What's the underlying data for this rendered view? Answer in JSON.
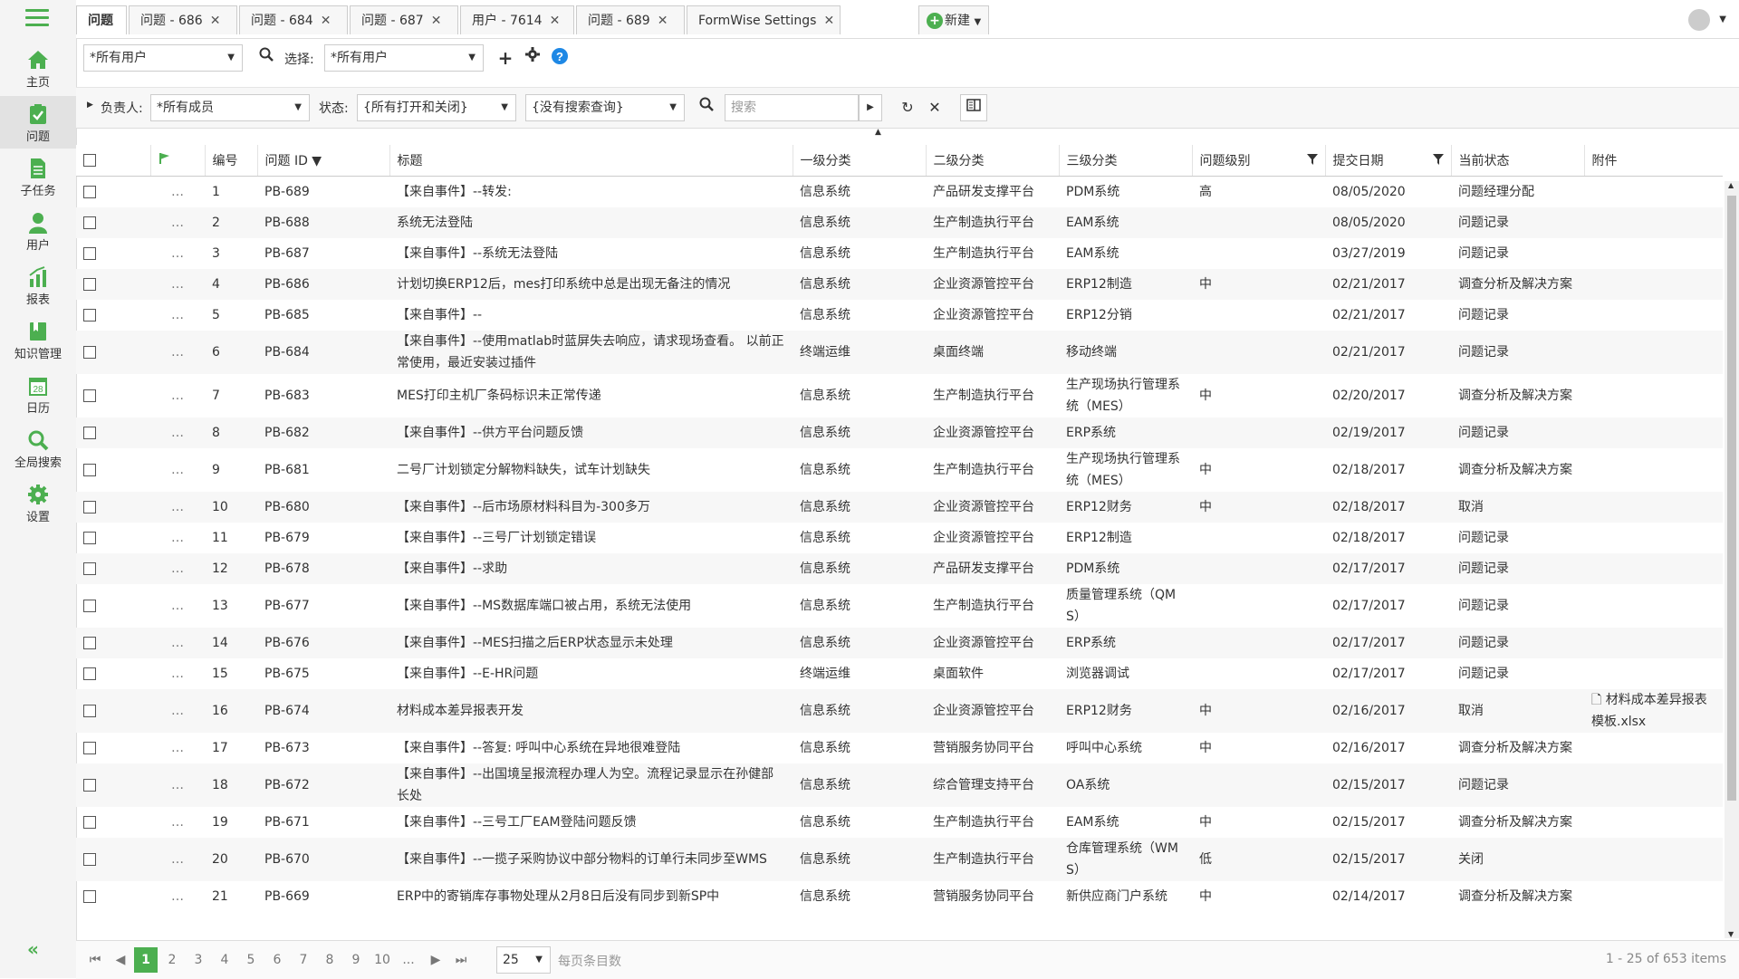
{
  "sidebar": {
    "items": [
      {
        "label": "主页",
        "icon": "home-icon"
      },
      {
        "label": "问题",
        "icon": "issue-check-icon"
      },
      {
        "label": "子任务",
        "icon": "subtask-icon"
      },
      {
        "label": "用户",
        "icon": "user-icon"
      },
      {
        "label": "报表",
        "icon": "report-icon"
      },
      {
        "label": "知识管理",
        "icon": "book-icon"
      },
      {
        "label": "日历",
        "icon": "calendar-icon",
        "badge": "28"
      },
      {
        "label": "全局搜索",
        "icon": "search-icon"
      },
      {
        "label": "设置",
        "icon": "gear-icon"
      }
    ],
    "collapse": "«"
  },
  "tabs": [
    {
      "label": "问题"
    },
    {
      "label": "问题 - 686"
    },
    {
      "label": "问题 - 684"
    },
    {
      "label": "问题 - 687"
    },
    {
      "label": "用户 - 7614"
    },
    {
      "label": "问题 - 689"
    },
    {
      "label": "FormWise Settings"
    }
  ],
  "new_button": "新建",
  "toolbar": {
    "user_filter": "*所有用户",
    "select_label": "选择:",
    "select_value": "*所有用户"
  },
  "filters": {
    "assignee_label": "负责人:",
    "assignee_value": "*所有成员",
    "status_label": "状态:",
    "status_value": "{所有打开和关闭}",
    "query_value": "{没有搜索查询}",
    "search_placeholder": "搜索"
  },
  "columns": [
    "编号",
    "问题 ID ▼",
    "标题",
    "一级分类",
    "二级分类",
    "三级分类",
    "问题级别",
    "提交日期",
    "当前状态",
    "附件"
  ],
  "rows": [
    {
      "n": "1",
      "id": "PB-689",
      "title": "【来自事件】--转发:",
      "c1": "信息系统",
      "c2": "产品研发支撑平台",
      "c3": "PDM系统",
      "level": "高",
      "date": "08/05/2020",
      "status": "问题经理分配",
      "att": ""
    },
    {
      "n": "2",
      "id": "PB-688",
      "title": "系统无法登陆",
      "c1": "信息系统",
      "c2": "生产制造执行平台",
      "c3": "EAM系统",
      "level": "",
      "date": "08/05/2020",
      "status": "问题记录",
      "att": ""
    },
    {
      "n": "3",
      "id": "PB-687",
      "title": "【来自事件】--系统无法登陆",
      "c1": "信息系统",
      "c2": "生产制造执行平台",
      "c3": "EAM系统",
      "level": "",
      "date": "03/27/2019",
      "status": "问题记录",
      "att": ""
    },
    {
      "n": "4",
      "id": "PB-686",
      "title": "计划切换ERP12后，mes打印系统中总是出现无备注的情况",
      "c1": "信息系统",
      "c2": "企业资源管控平台",
      "c3": "ERP12制造",
      "level": "中",
      "date": "02/21/2017",
      "status": "调查分析及解决方案",
      "att": ""
    },
    {
      "n": "5",
      "id": "PB-685",
      "title": "【来自事件】--",
      "c1": "信息系统",
      "c2": "企业资源管控平台",
      "c3": "ERP12分销",
      "level": "",
      "date": "02/21/2017",
      "status": "问题记录",
      "att": ""
    },
    {
      "n": "6",
      "id": "PB-684",
      "title": "【来自事件】--使用matlab时蓝屏失去响应，请求现场查看。 以前正常使用，最近安装过插件",
      "c1": "终端运维",
      "c2": "桌面终端",
      "c3": "移动终端",
      "level": "",
      "date": "02/21/2017",
      "status": "问题记录",
      "att": ""
    },
    {
      "n": "7",
      "id": "PB-683",
      "title": "MES打印主机厂条码标识未正常传递",
      "c1": "信息系统",
      "c2": "生产制造执行平台",
      "c3": "生产现场执行管理系统（MES）",
      "level": "中",
      "date": "02/20/2017",
      "status": "调查分析及解决方案",
      "att": ""
    },
    {
      "n": "8",
      "id": "PB-682",
      "title": "【来自事件】--供方平台问题反馈",
      "c1": "信息系统",
      "c2": "企业资源管控平台",
      "c3": "ERP系统",
      "level": "",
      "date": "02/19/2017",
      "status": "问题记录",
      "att": ""
    },
    {
      "n": "9",
      "id": "PB-681",
      "title": "二号厂计划锁定分解物料缺失，试车计划缺失",
      "c1": "信息系统",
      "c2": "生产制造执行平台",
      "c3": "生产现场执行管理系统（MES）",
      "level": "中",
      "date": "02/18/2017",
      "status": "调查分析及解决方案",
      "att": ""
    },
    {
      "n": "10",
      "id": "PB-680",
      "title": "【来自事件】--后市场原材料科目为-300多万",
      "c1": "信息系统",
      "c2": "企业资源管控平台",
      "c3": "ERP12财务",
      "level": "中",
      "date": "02/18/2017",
      "status": "取消",
      "att": ""
    },
    {
      "n": "11",
      "id": "PB-679",
      "title": "【来自事件】--三号厂计划锁定错误",
      "c1": "信息系统",
      "c2": "企业资源管控平台",
      "c3": "ERP12制造",
      "level": "",
      "date": "02/18/2017",
      "status": "问题记录",
      "att": ""
    },
    {
      "n": "12",
      "id": "PB-678",
      "title": "【来自事件】--求助",
      "c1": "信息系统",
      "c2": "产品研发支撑平台",
      "c3": "PDM系统",
      "level": "",
      "date": "02/17/2017",
      "status": "问题记录",
      "att": ""
    },
    {
      "n": "13",
      "id": "PB-677",
      "title": "【来自事件】--MS数据库端口被占用，系统无法使用",
      "c1": "信息系统",
      "c2": "生产制造执行平台",
      "c3": "质量管理系统（QMS）",
      "level": "",
      "date": "02/17/2017",
      "status": "问题记录",
      "att": ""
    },
    {
      "n": "14",
      "id": "PB-676",
      "title": "【来自事件】--MES扫描之后ERP状态显示未处理",
      "c1": "信息系统",
      "c2": "企业资源管控平台",
      "c3": "ERP系统",
      "level": "",
      "date": "02/17/2017",
      "status": "问题记录",
      "att": ""
    },
    {
      "n": "15",
      "id": "PB-675",
      "title": "【来自事件】--E-HR问题",
      "c1": "终端运维",
      "c2": "桌面软件",
      "c3": "浏览器调试",
      "level": "",
      "date": "02/17/2017",
      "status": "问题记录",
      "att": ""
    },
    {
      "n": "16",
      "id": "PB-674",
      "title": "材料成本差异报表开发",
      "c1": "信息系统",
      "c2": "企业资源管控平台",
      "c3": "ERP12财务",
      "level": "中",
      "date": "02/16/2017",
      "status": "取消",
      "att": "材料成本差异报表模板.xlsx"
    },
    {
      "n": "17",
      "id": "PB-673",
      "title": "【来自事件】--答复: 呼叫中心系统在异地很难登陆",
      "c1": "信息系统",
      "c2": "营销服务协同平台",
      "c3": "呼叫中心系统",
      "level": "中",
      "date": "02/16/2017",
      "status": "调查分析及解决方案",
      "att": ""
    },
    {
      "n": "18",
      "id": "PB-672",
      "title": "【来自事件】--出国境呈报流程办理人为空。流程记录显示在孙健部长处",
      "c1": "信息系统",
      "c2": "综合管理支持平台",
      "c3": "OA系统",
      "level": "",
      "date": "02/15/2017",
      "status": "问题记录",
      "att": ""
    },
    {
      "n": "19",
      "id": "PB-671",
      "title": "【来自事件】--三号工厂EAM登陆问题反馈",
      "c1": "信息系统",
      "c2": "生产制造执行平台",
      "c3": "EAM系统",
      "level": "中",
      "date": "02/15/2017",
      "status": "调查分析及解决方案",
      "att": ""
    },
    {
      "n": "20",
      "id": "PB-670",
      "title": "【来自事件】--一揽子采购协议中部分物料的订单行未同步至WMS",
      "c1": "信息系统",
      "c2": "生产制造执行平台",
      "c3": "仓库管理系统（WMS）",
      "level": "低",
      "date": "02/15/2017",
      "status": "关闭",
      "att": ""
    },
    {
      "n": "21",
      "id": "PB-669",
      "title": "ERP中的寄销库存事物处理从2月8日后没有同步到新SP中",
      "c1": "信息系统",
      "c2": "营销服务协同平台",
      "c3": "新供应商门户系统",
      "level": "中",
      "date": "02/14/2017",
      "status": "调查分析及解决方案",
      "att": ""
    }
  ],
  "pagination": {
    "pages": [
      "1",
      "2",
      "3",
      "4",
      "5",
      "6",
      "7",
      "8",
      "9",
      "10",
      "..."
    ],
    "current": "1",
    "page_size": "25",
    "page_size_label": "每页条目数",
    "info": "1 - 25 of 653 items"
  },
  "colors": {
    "accent": "#4caf50",
    "help": "#1e88e5"
  }
}
